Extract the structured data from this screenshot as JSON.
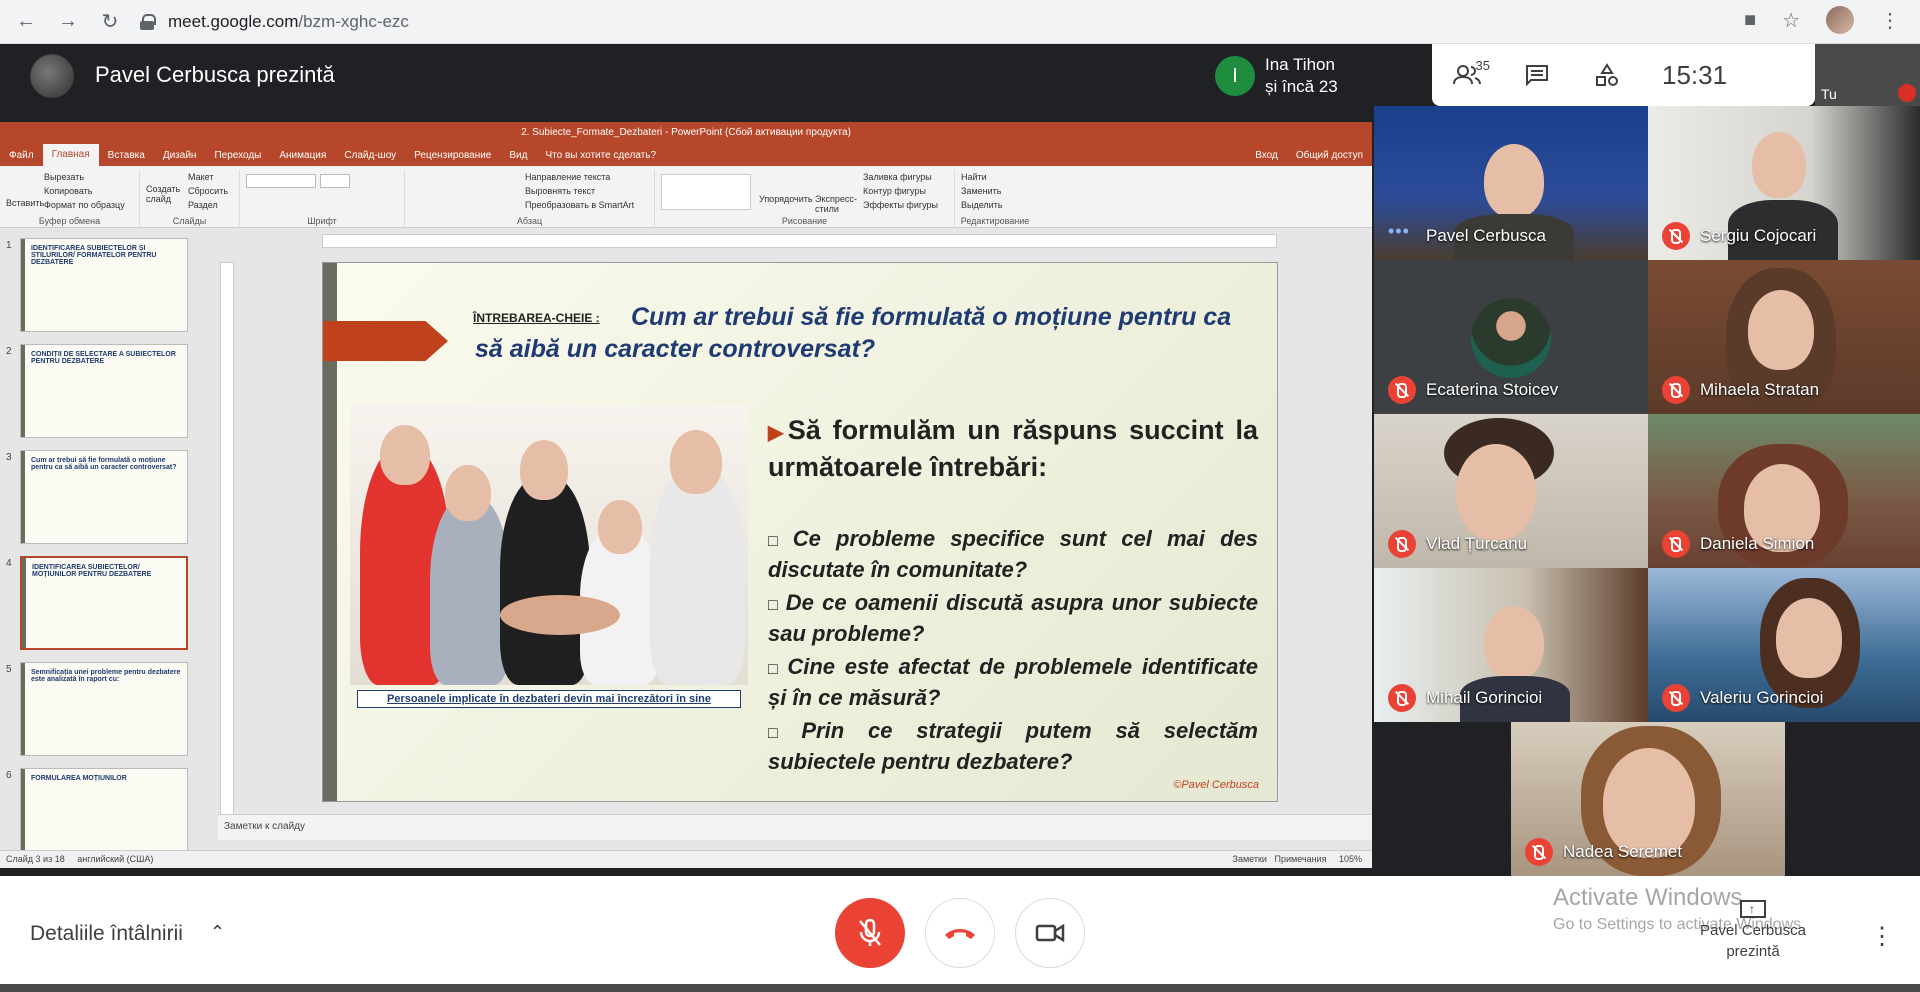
{
  "browser": {
    "url_domain": "meet.google.com",
    "url_path": "/bzm-xghc-ezc"
  },
  "meet": {
    "presenter_title": "Pavel Cerbusca prezintă",
    "joined_initial": "I",
    "joined_name": "Ina Tihon",
    "joined_more": "și încă 23",
    "participants_count": "35",
    "clock": "15:31",
    "self_label": "Tu",
    "colors": {
      "red": "#ea4335",
      "green": "#1e8e3e",
      "ppt_accent": "#b7472a"
    }
  },
  "ppt": {
    "window_title": "2. Subiecte_Formate_Dezbateri - PowerPoint (Сбой активации продукта)",
    "menu": [
      "Файл",
      "Главная",
      "Вставка",
      "Дизайн",
      "Переходы",
      "Анимация",
      "Слайд-шоу",
      "Рецензирование",
      "Вид",
      "Что вы хотите сделать?"
    ],
    "menu_right": [
      "Вход",
      "Общий доступ"
    ],
    "ribbon": {
      "clipboard": "Буфер обмена",
      "slides": "Слайды",
      "font": "Шрифт",
      "paragraph": "Абзац",
      "drawing": "Рисование",
      "editing": "Редактирование",
      "paste": "Вставить",
      "cut": "Вырезать",
      "copy": "Копировать",
      "format_painter": "Формат по образцу",
      "new_slide": "Создать слайд",
      "layout": "Макет",
      "reset": "Сбросить",
      "section": "Раздел",
      "text_direction": "Направление текста",
      "align_text": "Выровнять текст",
      "smartart": "Преобразовать в SmartArt",
      "arrange": "Упорядочить",
      "quick_styles": "Экспресс-стили",
      "shape_fill": "Заливка фигуры",
      "shape_outline": "Контур фигуры",
      "shape_effects": "Эффекты фигуры",
      "find": "Найти",
      "replace": "Заменить",
      "select": "Выделить"
    },
    "thumbnails": [
      {
        "num": "1",
        "title": "IDENTIFICAREA SUBIECTELOR ȘI STILURILOR/ FORMATELOR PENTRU DEZBATERE"
      },
      {
        "num": "2",
        "title": "CONDIȚII DE SELECTARE A SUBIECTELOR PENTRU DEZBATERE"
      },
      {
        "num": "3",
        "title": "Cum ar trebui să fie formulată o moțiune pentru ca să aibă un caracter controversat?"
      },
      {
        "num": "4",
        "title": "IDENTIFICAREA SUBIECTELOR/ MOȚIUNILOR PENTRU DEZBATERE"
      },
      {
        "num": "5",
        "title": "Semnificația unei probleme pentru dezbatere este analizată în raport cu:"
      },
      {
        "num": "6",
        "title": "FORMULAREA MOȚIUNILOR"
      }
    ],
    "slide": {
      "question_label": "ÎNTREBAREA-CHEIE :",
      "question": "Cum ar trebui să fie formulată o moțiune pentru ca să aibă un caracter controversat?",
      "caption": "Persoanele implicate în dezbateri devin mai încrezători în sine",
      "answer_heading": "Să formulăm un răspuns succint la următoarele întrebări:",
      "questions": [
        "Ce probleme specifice sunt cel mai des discutate în comunitate?",
        "De ce oamenii discută asupra unor subiecte sau probleme?",
        "Cine este afectat de problemele identificate și în ce măsură?",
        "Prin ce strategii putem să selectăm subiectele pentru dezbatere?"
      ],
      "copyright": "©Pavel Cerbusca"
    },
    "notes_placeholder": "Заметки к слайду",
    "status_left": "Слайд 3 из 18",
    "status_lang": "английский (США)",
    "status_notes": "Заметки",
    "status_comments": "Примечания",
    "zoom": "105%"
  },
  "participants": [
    {
      "name": "Pavel Cerbusca",
      "speaking": true
    },
    {
      "name": "Sergiu Cojocari",
      "muted": true
    },
    {
      "name": "Ecaterina Stoicev",
      "muted": true
    },
    {
      "name": "Mihaela Stratan",
      "muted": true
    },
    {
      "name": "Vlad Țurcanu",
      "muted": true
    },
    {
      "name": "Daniela Simion",
      "muted": true
    },
    {
      "name": "Mihail Gorincioi",
      "muted": true
    },
    {
      "name": "Valeriu Gorincioi",
      "muted": true
    },
    {
      "name": "Nadea Seremet",
      "muted": true
    }
  ],
  "bottom": {
    "details": "Detaliile întâlnirii",
    "activate_title": "Activate Windows",
    "activate_sub": "Go to Settings to activate Windows.",
    "presenting": "Pavel Cerbusca prezintă"
  }
}
